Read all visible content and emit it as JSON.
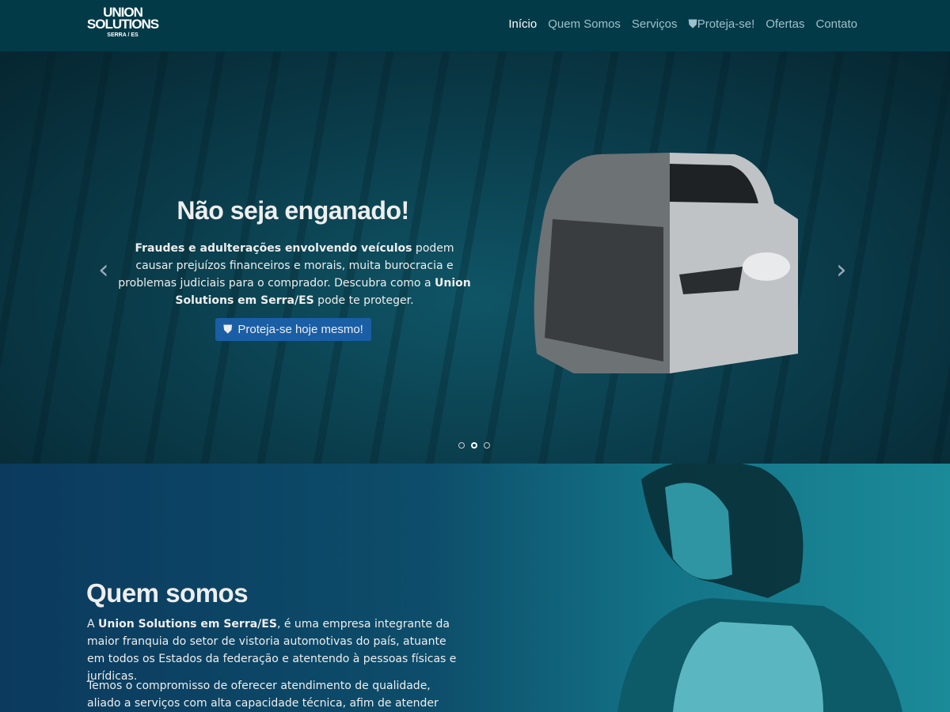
{
  "nav": {
    "logo": {
      "line1": "UNION",
      "line2": "SOLUTIONS",
      "line3": "SERRA / ES"
    },
    "items": [
      {
        "label": "Início",
        "active": true
      },
      {
        "label": "Quem Somos"
      },
      {
        "label": "Serviços"
      },
      {
        "label": "Proteja-se!",
        "icon": "shield-icon"
      },
      {
        "label": "Ofertas"
      },
      {
        "label": "Contato"
      }
    ]
  },
  "hero": {
    "title": "Não seja enganado!",
    "text": {
      "b1": "Fraudes e adulterações envolvendo veículos",
      "t1": " podem causar prejuízos financeiros e morais, muita burocracia e problemas judiciais para o comprador. Descubra como a ",
      "b2": "Union Solutions em Serra/ES",
      "t2": " pode te proteger."
    },
    "cta": "Proteja-se hoje mesmo!",
    "prev": "‹",
    "next": "›",
    "slides": 3,
    "active_slide": 2
  },
  "about": {
    "title": "Quem somos",
    "p1": {
      "t0": "A ",
      "b1": "Union Solutions em Serra/ES",
      "t1": ", é uma empresa integrante da maior franquia do setor de vistoria automotivas do país, atuante em todos os Estados da federação e atentendo à pessoas físicas e jurídicas."
    },
    "p2": "Temos o compromisso de oferecer atendimento de qualidade, aliado a serviços com alta capacidade técnica, afim de atender aos nossos"
  },
  "colors": {
    "nav": "#033a48",
    "cta": "#1a5ea6"
  }
}
